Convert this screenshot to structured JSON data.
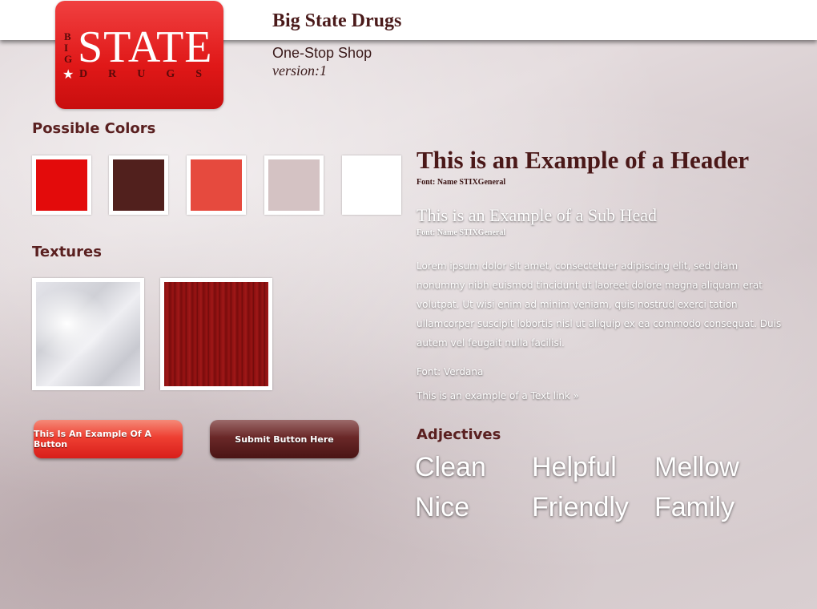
{
  "logo": {
    "big_letters": [
      "B",
      "I",
      "G"
    ],
    "state": "STATE",
    "drugs": "DRUGS",
    "star": "★"
  },
  "header": {
    "title": "Big State Drugs",
    "subtitle": "One-Stop Shop",
    "version": "version:1"
  },
  "colors": {
    "heading": "Possible Colors",
    "swatches": [
      "#e30b0b",
      "#51201d",
      "#e64a3e",
      "#d4c2c3",
      "#ffffff"
    ]
  },
  "textures": {
    "heading": "Textures",
    "items": [
      "white-cloth-texture",
      "red-wood-texture"
    ]
  },
  "buttons": {
    "primary_label": "This Is An Example Of A Button",
    "submit_label": "Submit Button Here"
  },
  "typography": {
    "header_example": "This is an Example of a Header",
    "header_font": "Font: Name STIXGeneral",
    "subhead_example": "This is an Example of a Sub Head",
    "subhead_font": "Font: Name STIXGeneral",
    "lorem": "Lorem ipsum dolor sit amet, consectetuer adipiscing elit, sed diam nonummy nibh euismod tincidunt ut laoreet dolore magna aliquam erat volutpat. Ut wisi enim ad minim veniam, quis nostrud exerci tation ullamcorper suscipit lobortis nisl ut aliquip ex ea commodo consequat. Duis autem vel feugait nulla facilisi.",
    "body_font": "Font: Verdana",
    "text_link": "This is an example of a Text link »"
  },
  "adjectives": {
    "heading": "Adjectives",
    "words": [
      "Clean",
      "Helpful",
      "Mellow",
      "Nice",
      "Friendly",
      "Family"
    ]
  }
}
